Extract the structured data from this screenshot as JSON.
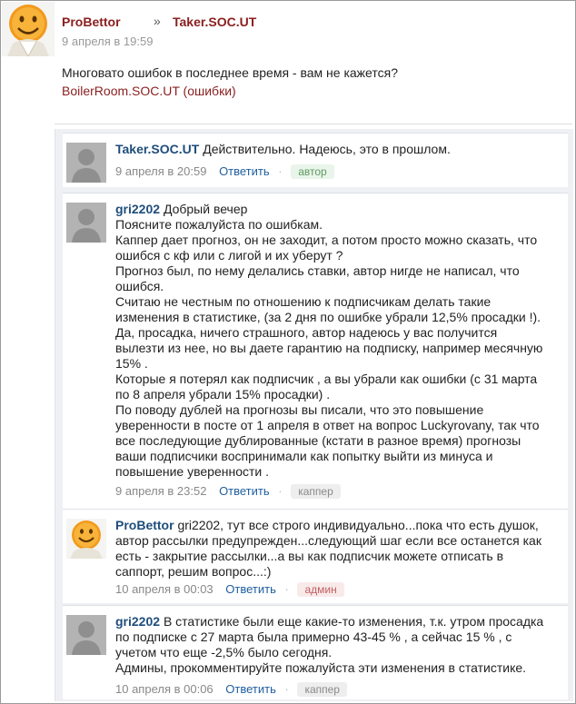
{
  "post": {
    "author": "ProBettor",
    "separator": "»",
    "target": "Taker.SOC.UT",
    "time": "9 апреля в 19:59",
    "text": "Многовато ошибок в последнее время - вам не кажется?",
    "link": "BoilerRoom.SOC.UT (ошибки)"
  },
  "comments": [
    {
      "author": "Taker.SOC.UT",
      "lines": [
        "Действительно. Надеюсь, это в прошлом."
      ],
      "time": "9 апреля в 20:59",
      "reply": "Ответить",
      "badge": "автор"
    },
    {
      "author": "gri2202",
      "lines": [
        "Добрый вечер",
        "Поясните пожалуйста по ошибкам.",
        "Каппер дает прогноз, он не заходит, а потом просто можно сказать, что",
        "ошибся с кф или с лигой и их уберут ?",
        "Прогноз был, по нему делались ставки, автор нигде не написал, что",
        "ошибся.",
        "Считаю не честным по отношению к подписчикам делать такие",
        "изменения в статистике, (за 2 дня по ошибке убрали 12,5% просадки !).",
        "Да, просадка, ничего страшного, автор надеюсь у вас получится",
        "вылезти из нее, но вы даете гарантию на подписку, например месячную",
        "15% .",
        "Которые я потерял как подписчик , а вы убрали как ошибки (с 31 марта",
        "по 8 апреля убрали 15% просадки) .",
        "По поводу дублей на прогнозы вы писали, что это повышение",
        "уверенности в посте от 1 апреля в ответ на вопрос Luckyrovany, так что",
        "все последующие дублированные (кстати в разное время) прогнозы",
        "ваши подписчики воспринимали как попытку выйти из минуса и",
        "повышение уверенности ."
      ],
      "time": "9 апреля в 23:52",
      "reply": "Ответить",
      "badge": "каппер"
    },
    {
      "author": "ProBettor",
      "lines": [
        "gri2202, тут все строго индивидуально...пока что есть душок,",
        "автор рассылки предупрежден...следующий шаг если все останется как",
        "есть - закрытие рассылки...а вы как подписчик можете отписать в",
        "саппорт, решим вопрос...:)"
      ],
      "time": "10 апреля в 00:03",
      "reply": "Ответить",
      "badge": "админ"
    },
    {
      "author": "gri2202",
      "lines": [
        "В статистике были еще какие-то изменения, т.к. утром просадка",
        "по подписке с 27 марта была примерно 43-45 % , а сейчас 15 % , с",
        "учетом что еще -2,5% было сегодня.",
        "Админы, прокомментируйте пожалуйста эти изменения в статистике."
      ],
      "time": "10 апреля в 00:06",
      "reply": "Ответить",
      "badge": "каппер"
    }
  ],
  "colors": {
    "author_red": "#8b1e1e",
    "author_blue": "#1e4d7b",
    "reply_link": "#1e5e9e",
    "thread_bg": "#eef0f3"
  },
  "icons": {
    "post_avatar": "smiley-avatar-icon",
    "default_avatar": "default-user-avatar-icon"
  }
}
